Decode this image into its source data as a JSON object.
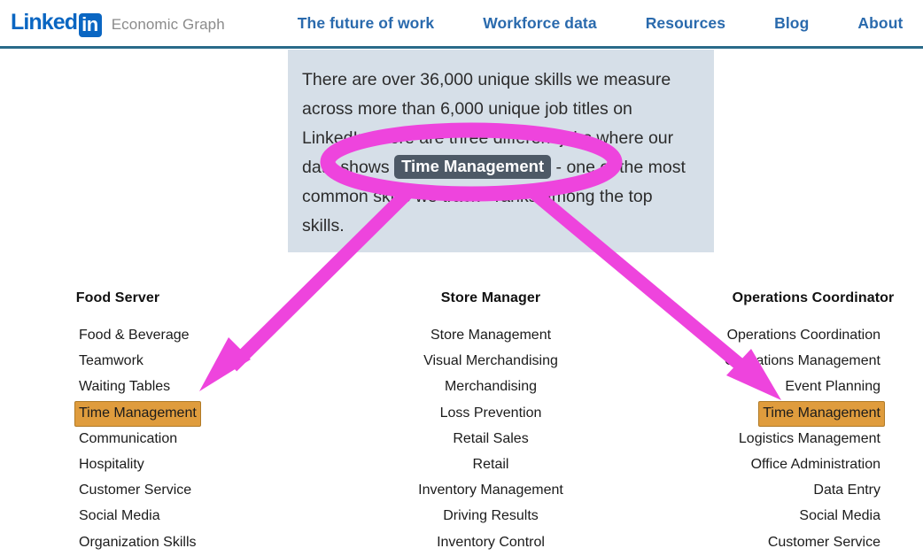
{
  "header": {
    "brand_name": "Linked",
    "brand_badge": "in",
    "brand_subtitle": "Economic Graph",
    "nav": [
      {
        "id": "future",
        "label": "The future of work"
      },
      {
        "id": "workforce",
        "label": "Workforce data"
      },
      {
        "id": "resources",
        "label": "Resources"
      },
      {
        "id": "blog",
        "label": "Blog"
      },
      {
        "id": "about",
        "label": "About"
      }
    ],
    "nav_color": "#2a6aad",
    "border_color": "#2a6b8a",
    "brand_color": "#0a66c2"
  },
  "callout": {
    "text_part_1": "There are over 36,000 unique skills we measure across more than 6,000 unique job titles on LinkedIn. Here are three different jobs where our data shows ",
    "badge_label": "Time Management",
    "text_part_2": " - one of the most common skills we track - ranks among the top skills.",
    "background_color": "#d6dfe8",
    "badge_background": "#4d5966"
  },
  "annotation": {
    "color": "#ee44dd",
    "ellipse_label": "highlight-ellipse",
    "arrow_left_label": "arrow-to-food-server",
    "arrow_right_label": "arrow-to-operations-coordinator"
  },
  "columns": [
    {
      "id": "food-server",
      "title": "Food Server",
      "align": "left",
      "skills": [
        {
          "label": "Food & Beverage",
          "highlighted": false
        },
        {
          "label": "Teamwork",
          "highlighted": false
        },
        {
          "label": "Waiting Tables",
          "highlighted": false
        },
        {
          "label": "Time Management",
          "highlighted": true
        },
        {
          "label": "Communication",
          "highlighted": false
        },
        {
          "label": "Hospitality",
          "highlighted": false
        },
        {
          "label": "Customer Service",
          "highlighted": false
        },
        {
          "label": "Social Media",
          "highlighted": false
        },
        {
          "label": "Organization Skills",
          "highlighted": false
        }
      ]
    },
    {
      "id": "store-manager",
      "title": "Store Manager",
      "align": "center",
      "skills": [
        {
          "label": "Store Management",
          "highlighted": false
        },
        {
          "label": "Visual Merchandising",
          "highlighted": false
        },
        {
          "label": "Merchandising",
          "highlighted": false
        },
        {
          "label": "Loss Prevention",
          "highlighted": false
        },
        {
          "label": "Retail Sales",
          "highlighted": false
        },
        {
          "label": "Retail",
          "highlighted": false
        },
        {
          "label": "Inventory Management",
          "highlighted": false
        },
        {
          "label": "Driving Results",
          "highlighted": false
        },
        {
          "label": "Inventory Control",
          "highlighted": false
        }
      ]
    },
    {
      "id": "operations-coordinator",
      "title": "Operations Coordinator",
      "align": "right",
      "skills": [
        {
          "label": "Operations Coordination",
          "highlighted": false
        },
        {
          "label": "Operations Management",
          "highlighted": false
        },
        {
          "label": "Event Planning",
          "highlighted": false
        },
        {
          "label": "Time Management",
          "highlighted": true
        },
        {
          "label": "Logistics Management",
          "highlighted": false
        },
        {
          "label": "Office Administration",
          "highlighted": false
        },
        {
          "label": "Data Entry",
          "highlighted": false
        },
        {
          "label": "Social Media",
          "highlighted": false
        },
        {
          "label": "Customer Service",
          "highlighted": false
        }
      ]
    }
  ],
  "highlight_chip_color": "#df9c3d"
}
